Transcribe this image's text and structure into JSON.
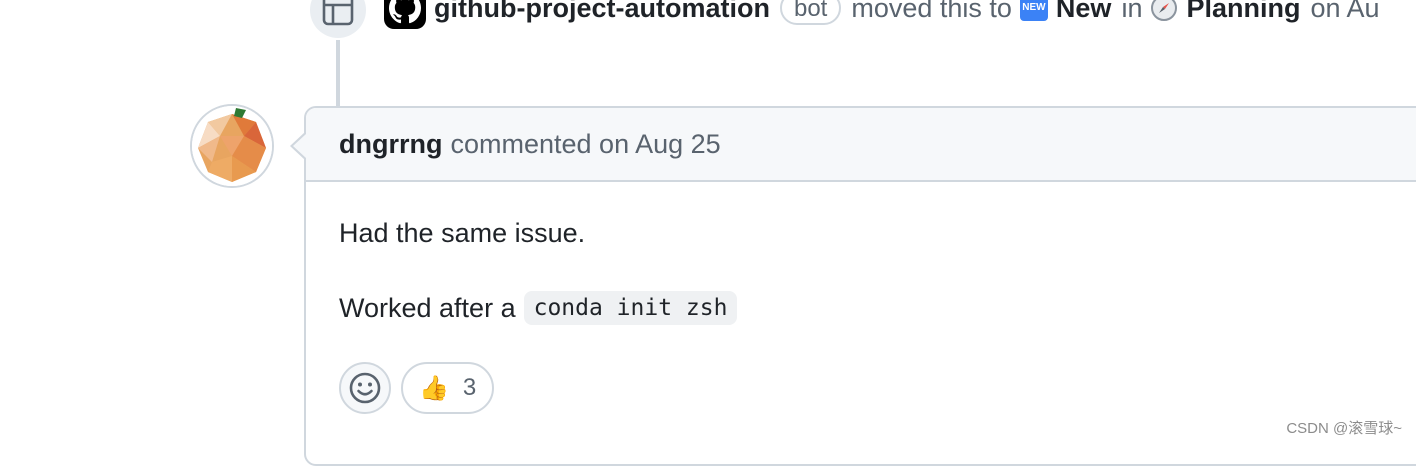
{
  "event": {
    "actor": "github-project-automation",
    "badge": "bot",
    "action": "moved this to",
    "new_emoji_text": "NEW",
    "column": "New",
    "in_text": "in",
    "project": "Planning",
    "on_text": "on Au"
  },
  "comment": {
    "author": "dngrrng",
    "meta": "commented on Aug 25",
    "paragraph1": "Had the same issue.",
    "paragraph2_prefix": "Worked after a",
    "code": "conda init zsh"
  },
  "reactions": [
    {
      "emoji": "👍",
      "count": "3"
    }
  ],
  "watermark": "CSDN @滚雪球~"
}
